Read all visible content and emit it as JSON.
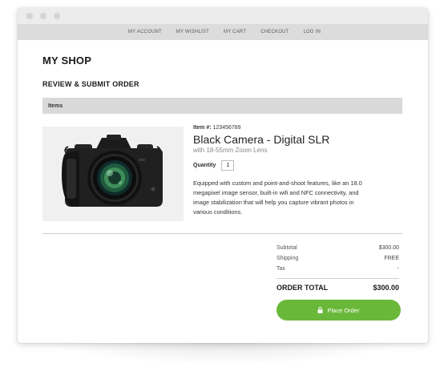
{
  "window": {
    "titlebar_dots": 3
  },
  "nav": {
    "items": [
      "MY ACCOUNT",
      "MY WISHLIST",
      "MY CART",
      "CHECKOUT",
      "LOG IN"
    ]
  },
  "page": {
    "shop_title": "MY SHOP",
    "section_title": "REVIEW & SUBMIT ORDER",
    "items_header": "Items"
  },
  "product": {
    "item_label": "Item #:",
    "item_number": "123456789",
    "name": "Black Camera - Digital SLR",
    "subtitle": "with 18-55mm Zoom Lens",
    "quantity_label": "Quantity",
    "quantity_value": "1",
    "description": "Equipped with custom and point-and-shoot features, like an 18.0 megapixel image sensor, built-in wifi and NFC connectivity, and image stabilization that will help you capture vibrant photos in various conditions.",
    "image_icon": "camera-photo"
  },
  "totals": {
    "subtotal_label": "Subtotal",
    "subtotal_value": "$300.00",
    "shipping_label": "Shipping",
    "shipping_value": "FREE",
    "tax_label": "Tax",
    "tax_value": "-",
    "order_total_label": "ORDER TOTAL",
    "order_total_value": "$300.00"
  },
  "actions": {
    "place_order_label": "Place Order",
    "place_order_icon": "lock-icon",
    "place_order_color": "#6ab83a"
  }
}
